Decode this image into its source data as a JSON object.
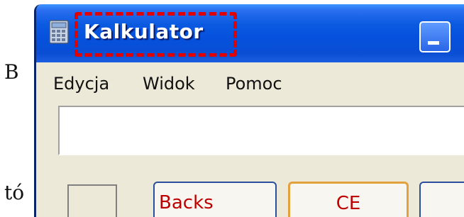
{
  "background": {
    "text_top": "B",
    "text_bottom": "tó"
  },
  "window": {
    "title": "Kalkulator",
    "app_icon": "calculator-icon",
    "minimize_icon": "minimize-icon"
  },
  "menu": {
    "items": [
      {
        "label": "Edycja"
      },
      {
        "label": "Widok"
      },
      {
        "label": "Pomoc"
      }
    ]
  },
  "display": {
    "value": ""
  },
  "buttons": {
    "backspace": "Backs",
    "ce": "CE",
    "c": ""
  },
  "colors": {
    "titlebar": "#0550dc",
    "highlight": "#e00000",
    "button_text": "#c00000"
  }
}
